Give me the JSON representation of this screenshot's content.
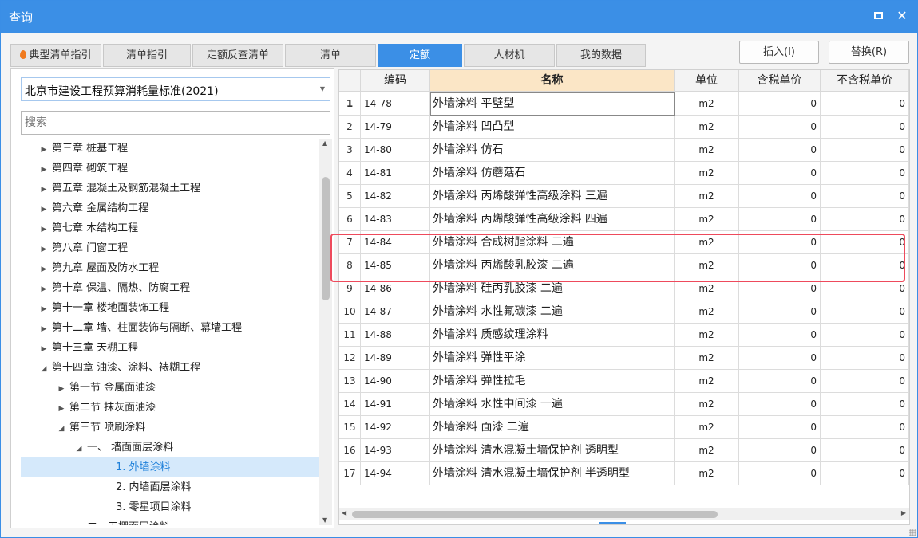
{
  "window": {
    "title": "查询"
  },
  "tabs": [
    {
      "label": "典型清单指引"
    },
    {
      "label": "清单指引"
    },
    {
      "label": "定额反查清单"
    },
    {
      "label": "清单"
    },
    {
      "label": "定额"
    },
    {
      "label": "人材机"
    },
    {
      "label": "我的数据"
    }
  ],
  "active_tab": "定额",
  "toolbar": {
    "insert_label": "插入(I)",
    "replace_label": "替换(R)"
  },
  "left": {
    "library": "北京市建设工程预算消耗量标准(2021)",
    "search_placeholder": "搜索",
    "tree": [
      {
        "label": "第三章 桩基工程",
        "level": 0,
        "state": "collapsed"
      },
      {
        "label": "第四章 砌筑工程",
        "level": 0,
        "state": "collapsed"
      },
      {
        "label": "第五章 混凝土及钢筋混凝土工程",
        "level": 0,
        "state": "collapsed"
      },
      {
        "label": "第六章 金属结构工程",
        "level": 0,
        "state": "collapsed"
      },
      {
        "label": "第七章 木结构工程",
        "level": 0,
        "state": "collapsed"
      },
      {
        "label": "第八章 门窗工程",
        "level": 0,
        "state": "collapsed"
      },
      {
        "label": "第九章 屋面及防水工程",
        "level": 0,
        "state": "collapsed"
      },
      {
        "label": "第十章 保温、隔热、防腐工程",
        "level": 0,
        "state": "collapsed"
      },
      {
        "label": "第十一章 楼地面装饰工程",
        "level": 0,
        "state": "collapsed"
      },
      {
        "label": "第十二章 墙、柱面装饰与隔断、幕墙工程",
        "level": 0,
        "state": "collapsed"
      },
      {
        "label": "第十三章 天棚工程",
        "level": 0,
        "state": "collapsed"
      },
      {
        "label": "第十四章 油漆、涂料、裱糊工程",
        "level": 0,
        "state": "expanded"
      },
      {
        "label": "第一节 金属面油漆",
        "level": 1,
        "state": "collapsed"
      },
      {
        "label": "第二节 抹灰面油漆",
        "level": 1,
        "state": "collapsed"
      },
      {
        "label": "第三节 喷刷涂料",
        "level": 1,
        "state": "expanded"
      },
      {
        "label": "一、 墙面面层涂料",
        "level": 2,
        "state": "expanded"
      },
      {
        "label": "1. 外墙涂料",
        "level": 3,
        "state": "leaf",
        "selected": true
      },
      {
        "label": "2. 内墙面层涂料",
        "level": 3,
        "state": "leaf"
      },
      {
        "label": "3. 零星项目涂料",
        "level": 3,
        "state": "leaf"
      },
      {
        "label": "二、天棚面层涂料",
        "level": 2,
        "state": "leaf"
      }
    ]
  },
  "grid": {
    "columns": [
      "",
      "编码",
      "名称",
      "单位",
      "含税单价",
      "不含税单价"
    ],
    "rows": [
      {
        "no": "1",
        "code": "14-78",
        "name": "外墙涂料 平壁型",
        "unit": "m2",
        "tax": "0",
        "notax": "0"
      },
      {
        "no": "2",
        "code": "14-79",
        "name": "外墙涂料 凹凸型",
        "unit": "m2",
        "tax": "0",
        "notax": "0"
      },
      {
        "no": "3",
        "code": "14-80",
        "name": "外墙涂料 仿石",
        "unit": "m2",
        "tax": "0",
        "notax": "0"
      },
      {
        "no": "4",
        "code": "14-81",
        "name": "外墙涂料 仿蘑菇石",
        "unit": "m2",
        "tax": "0",
        "notax": "0"
      },
      {
        "no": "5",
        "code": "14-82",
        "name": "外墙涂料 丙烯酸弹性高级涂料 三遍",
        "unit": "m2",
        "tax": "0",
        "notax": "0"
      },
      {
        "no": "6",
        "code": "14-83",
        "name": "外墙涂料 丙烯酸弹性高级涂料 四遍",
        "unit": "m2",
        "tax": "0",
        "notax": "0"
      },
      {
        "no": "7",
        "code": "14-84",
        "name": "外墙涂料 合成树脂涂料 二遍",
        "unit": "m2",
        "tax": "0",
        "notax": "0"
      },
      {
        "no": "8",
        "code": "14-85",
        "name": "外墙涂料 丙烯酸乳胶漆 二遍",
        "unit": "m2",
        "tax": "0",
        "notax": "0"
      },
      {
        "no": "9",
        "code": "14-86",
        "name": "外墙涂料 硅丙乳胶漆 二遍",
        "unit": "m2",
        "tax": "0",
        "notax": "0"
      },
      {
        "no": "10",
        "code": "14-87",
        "name": "外墙涂料 水性氟碳漆 二遍",
        "unit": "m2",
        "tax": "0",
        "notax": "0"
      },
      {
        "no": "11",
        "code": "14-88",
        "name": "外墙涂料 质感纹理涂料",
        "unit": "m2",
        "tax": "0",
        "notax": "0"
      },
      {
        "no": "12",
        "code": "14-89",
        "name": "外墙涂料 弹性平涂",
        "unit": "m2",
        "tax": "0",
        "notax": "0"
      },
      {
        "no": "13",
        "code": "14-90",
        "name": "外墙涂料 弹性拉毛",
        "unit": "m2",
        "tax": "0",
        "notax": "0"
      },
      {
        "no": "14",
        "code": "14-91",
        "name": "外墙涂料 水性中间漆 一遍",
        "unit": "m2",
        "tax": "0",
        "notax": "0"
      },
      {
        "no": "15",
        "code": "14-92",
        "name": "外墙涂料 面漆 二遍",
        "unit": "m2",
        "tax": "0",
        "notax": "0"
      },
      {
        "no": "16",
        "code": "14-93",
        "name": "外墙涂料 清水混凝土墙保护剂 透明型",
        "unit": "m2",
        "tax": "0",
        "notax": "0"
      },
      {
        "no": "17",
        "code": "14-94",
        "name": "外墙涂料 清水混凝土墙保护剂 半透明型",
        "unit": "m2",
        "tax": "0",
        "notax": "0"
      }
    ]
  },
  "colors": {
    "accent": "#3b8fe6",
    "highlight_border": "#ee4a5c",
    "header_highlight": "#fbe6c6",
    "selected_tree_bg": "#d5e9fb"
  }
}
